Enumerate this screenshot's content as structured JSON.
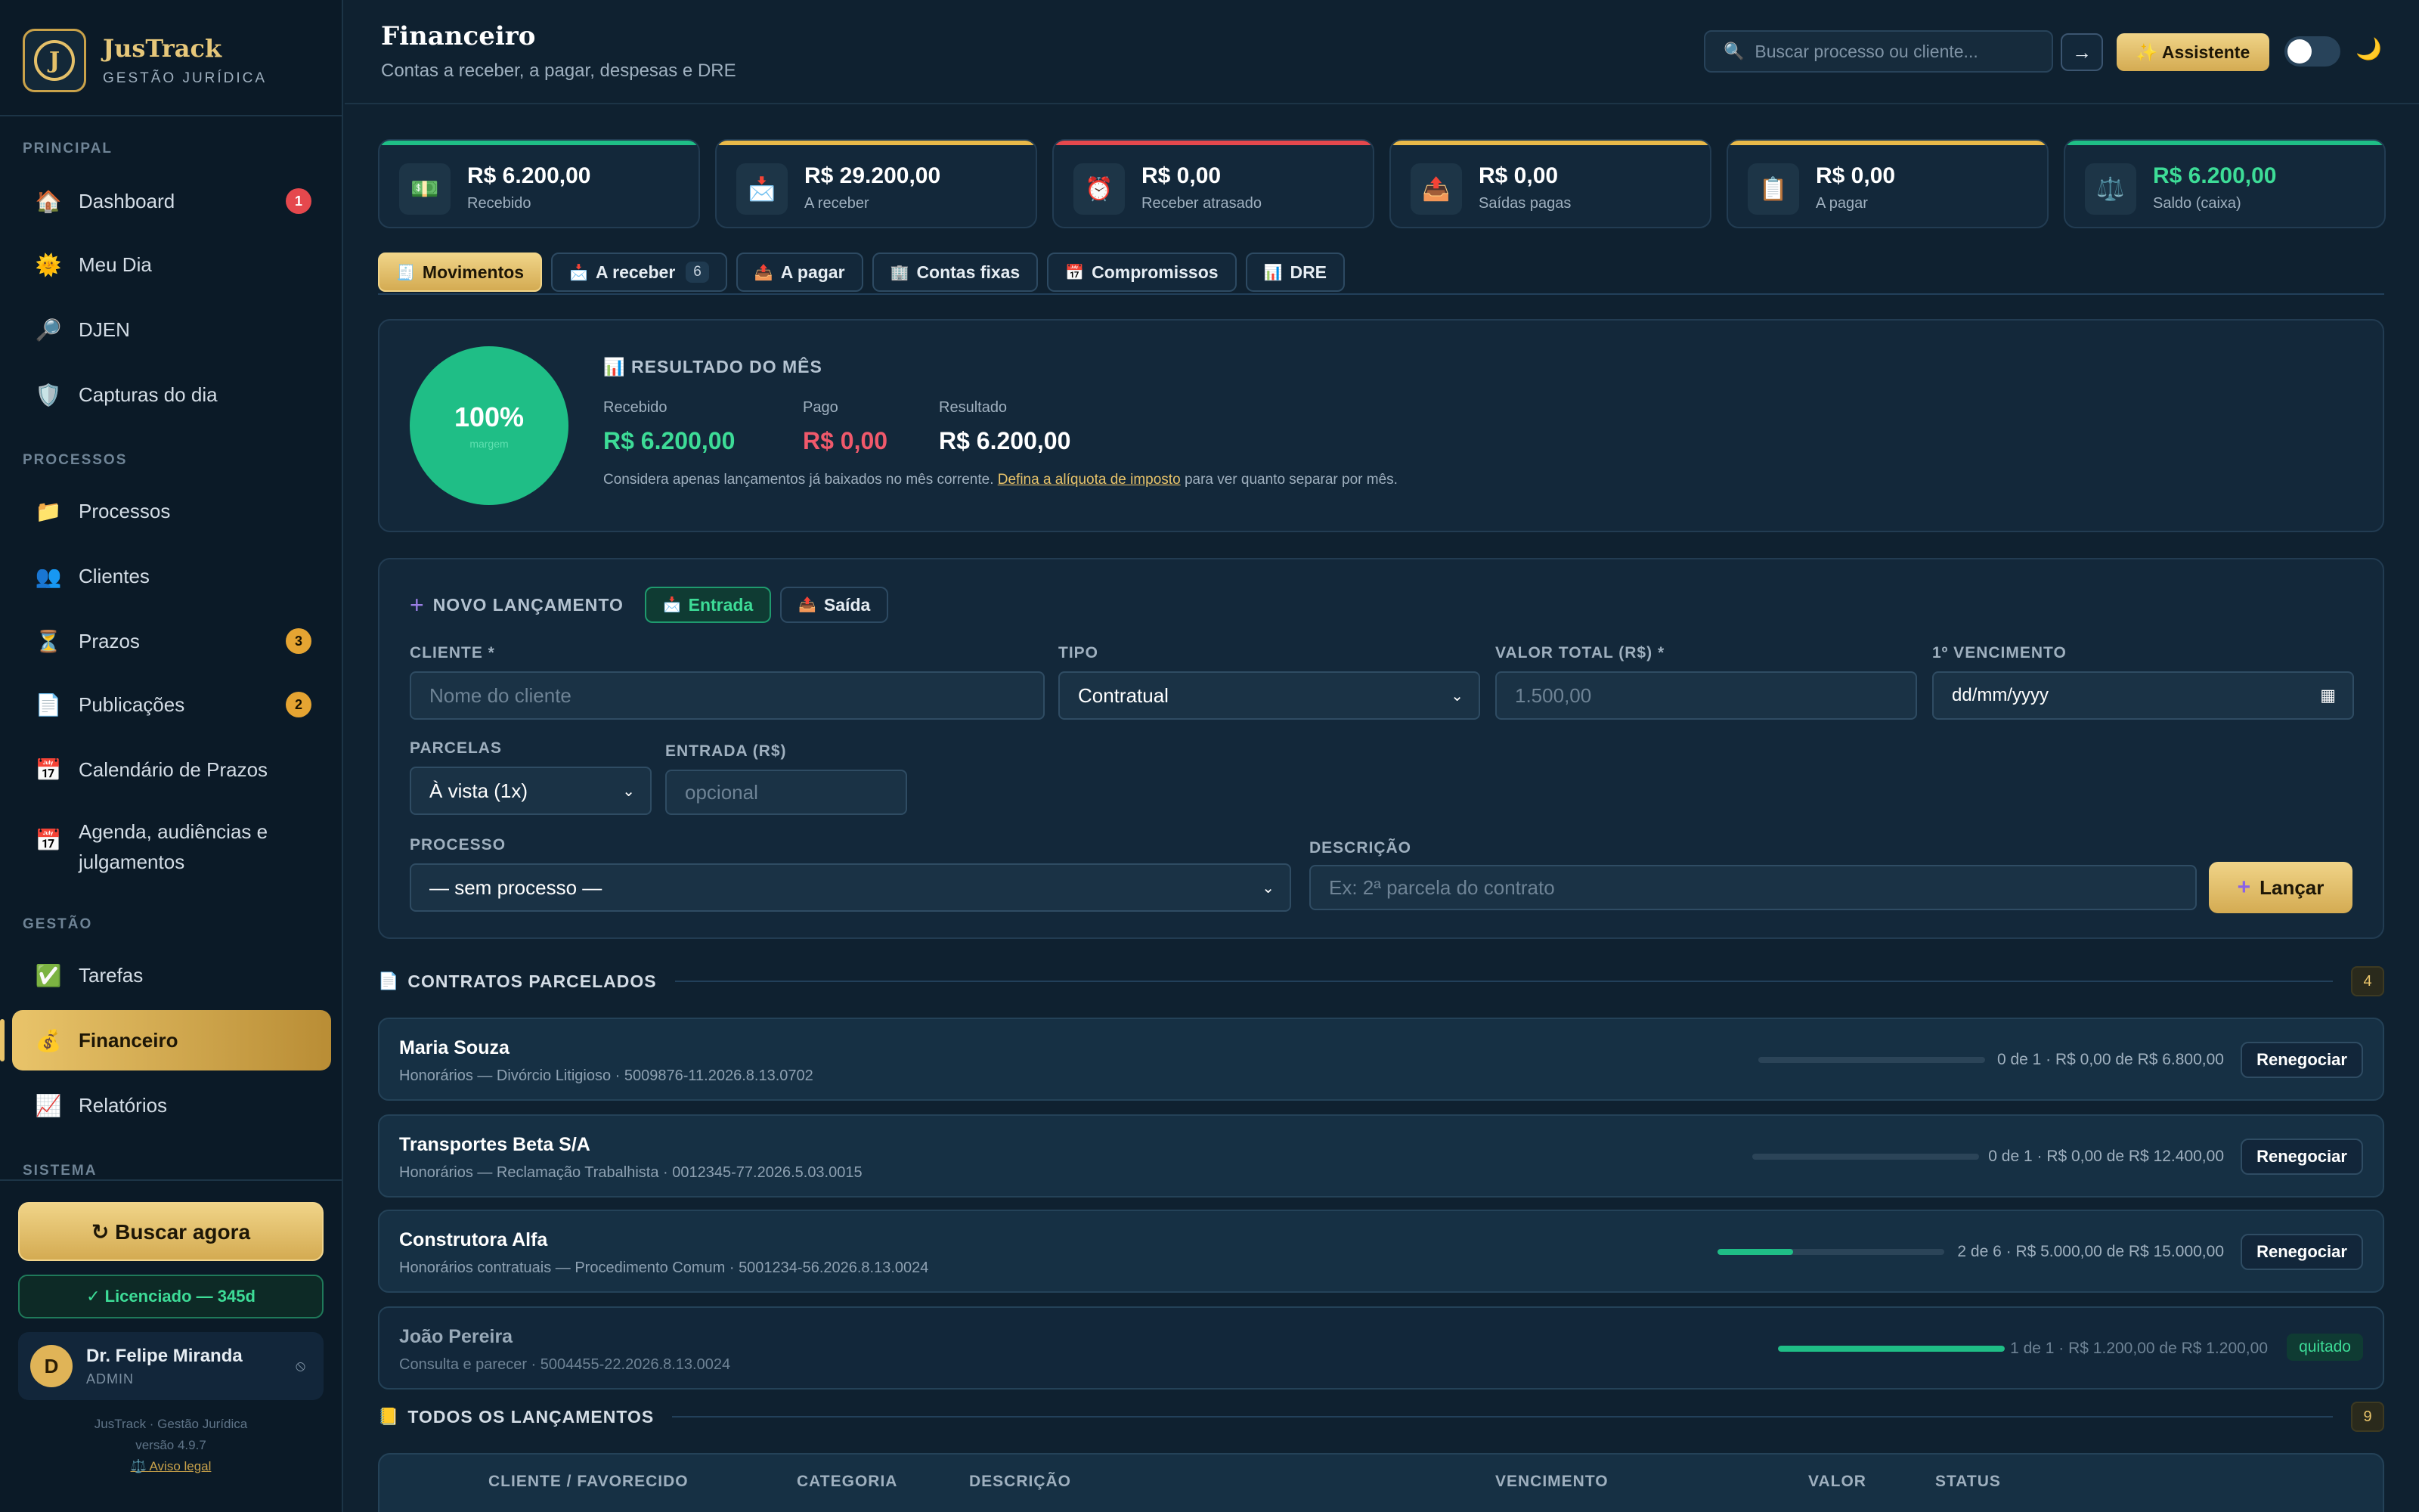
{
  "brand": {
    "logo_letter": "J",
    "name": "JusTrack",
    "subtitle": "GESTÃO JURÍDICA"
  },
  "sidebar": {
    "sections": {
      "principal": "PRINCIPAL",
      "processos": "PROCESSOS",
      "gestao": "GESTÃO",
      "sistema": "SISTEMA"
    },
    "items": [
      {
        "label": "Dashboard",
        "icon": "🏠",
        "icon_name": "home-icon",
        "badge": "1"
      },
      {
        "label": "Meu Dia",
        "icon": "🌞",
        "icon_name": "sun-icon"
      },
      {
        "label": "DJEN",
        "icon": "🔎",
        "icon_name": "search-icon"
      },
      {
        "label": "Capturas do dia",
        "icon": "🛡️",
        "icon_name": "shield-icon"
      },
      {
        "label": "Processos",
        "icon": "📁",
        "icon_name": "folder-icon"
      },
      {
        "label": "Clientes",
        "icon": "👥",
        "icon_name": "users-icon"
      },
      {
        "label": "Prazos",
        "icon": "⏳",
        "icon_name": "hourglass-icon",
        "badge": "3"
      },
      {
        "label": "Publicações",
        "icon": "📄",
        "icon_name": "document-icon",
        "badge": "2"
      },
      {
        "label": "Calendário de Prazos",
        "icon": "📅",
        "icon_name": "calendar-icon"
      },
      {
        "label_line1": "Agenda, audiências e",
        "label_line2": "julgamentos",
        "icon": "📅",
        "icon_name": "calendar-icon"
      },
      {
        "label": "Tarefas",
        "icon": "✅",
        "icon_name": "checkbox-icon"
      },
      {
        "label": "Financeiro",
        "icon": "💰",
        "icon_name": "money-bag-icon"
      },
      {
        "label": "Relatórios",
        "icon": "📈",
        "icon_name": "chart-icon"
      }
    ],
    "buscar_label": "↻ Buscar agora",
    "license": "✓ Licenciado — 345d",
    "user": {
      "initial": "D",
      "name": "Dr. Felipe Miranda",
      "role": "ADMIN",
      "logout_icon": "⦸"
    },
    "footer": {
      "line1": "JusTrack · Gestão Jurídica",
      "line2": "versão 4.9.7",
      "legal": "⚖️ Aviso legal"
    }
  },
  "header": {
    "title": "Financeiro",
    "subtitle": "Contas a receber, a pagar, despesas e DRE",
    "search_icon": "🔍",
    "search_placeholder": "Buscar processo ou cliente...",
    "go_label": "→",
    "assistant_label": "✨ Assistente",
    "theme_icon": "🌙"
  },
  "stats": [
    {
      "value": "R$ 6.200,00",
      "label": "Recebido",
      "icon": "💵",
      "accent": "#1fbe86",
      "value_color": "#ffffff"
    },
    {
      "value": "R$ 29.200,00",
      "label": "A receber",
      "icon": "📩",
      "accent": "#e9b949",
      "value_color": "#ffffff"
    },
    {
      "value": "R$ 0,00",
      "label": "Receber atrasado",
      "icon": "⏰",
      "accent": "#e5484d",
      "value_color": "#ffffff"
    },
    {
      "value": "R$ 0,00",
      "label": "Saídas pagas",
      "icon": "📤",
      "accent": "#e9b949",
      "value_color": "#ffffff"
    },
    {
      "value": "R$ 0,00",
      "label": "A pagar",
      "icon": "📋",
      "accent": "#e9b949",
      "value_color": "#ffffff"
    },
    {
      "value": "R$ 6.200,00",
      "label": "Saldo (caixa)",
      "icon": "⚖️",
      "accent": "#1fbe86",
      "value_color": "#3ddc97"
    }
  ],
  "tabs": [
    {
      "label": "Movimentos",
      "icon": "🧾"
    },
    {
      "label": "A receber",
      "icon": "📩",
      "count": "6"
    },
    {
      "label": "A pagar",
      "icon": "📤"
    },
    {
      "label": "Contas fixas",
      "icon": "🏢"
    },
    {
      "label": "Compromissos",
      "icon": "📅"
    },
    {
      "label": "DRE",
      "icon": "📊"
    }
  ],
  "result": {
    "percent": "100%",
    "percent_sub": "margem",
    "title_icon": "📊",
    "title": "RESULTADO DO MÊS",
    "received_label": "Recebido",
    "received_value": "R$ 6.200,00",
    "paid_label": "Pago",
    "paid_value": "R$ 0,00",
    "result_label": "Resultado",
    "result_value": "R$ 6.200,00",
    "note_before": "Considera apenas lançamentos já baixados no mês corrente.",
    "note_link": "Defina a alíquota de imposto",
    "note_after": "para ver quanto separar por mês."
  },
  "form": {
    "title": "NOVO LANÇAMENTO",
    "entrada_label": "Entrada",
    "saida_label": "Saída",
    "cliente_label": "CLIENTE *",
    "cliente_placeholder": "Nome do cliente",
    "tipo_label": "TIPO",
    "tipo_value": "Contratual",
    "valor_label": "VALOR TOTAL (R$) *",
    "valor_placeholder": "1.500,00",
    "venc_label": "1º VENCIMENTO",
    "venc_placeholder": "dd/mm/yyyy",
    "parcelas_label": "PARCELAS",
    "parcelas_value": "À vista (1x)",
    "entrada_valor_label": "ENTRADA (R$)",
    "entrada_placeholder": "opcional",
    "processo_label": "PROCESSO",
    "processo_value": "— sem processo —",
    "descricao_label": "DESCRIÇÃO",
    "descricao_placeholder": "Ex: 2ª parcela do contrato",
    "submit_label": "Lançar"
  },
  "contracts": {
    "title": "CONTRATOS PARCELADOS",
    "count": "4",
    "rows": [
      {
        "name": "Maria Souza",
        "desc": "Honorários — Divórcio Litigioso · 5009876-11.2026.8.13.0702",
        "progress": 0,
        "info": "0 de 1 · R$ 0,00 de R$ 6.800,00",
        "action": "Renegociar"
      },
      {
        "name": "Transportes Beta S/A",
        "desc": "Honorários — Reclamação Trabalhista · 0012345-77.2026.5.03.0015",
        "progress": 0,
        "info": "0 de 1 · R$ 0,00 de R$ 12.400,00",
        "action": "Renegociar"
      },
      {
        "name": "Construtora Alfa",
        "desc": "Honorários contratuais — Procedimento Comum · 5001234-56.2026.8.13.0024",
        "progress": 0.333,
        "info": "2 de 6 · R$ 5.000,00 de R$ 15.000,00",
        "action": "Renegociar"
      },
      {
        "name": "João Pereira",
        "desc": "Consulta e parecer · 5004455-22.2026.8.13.0024",
        "progress": 1,
        "info": "1 de 1 · R$ 1.200,00 de R$ 1.200,00",
        "status": "quitado"
      }
    ]
  },
  "launches": {
    "title": "TODOS OS LANÇAMENTOS",
    "count": "9",
    "columns": [
      "CLIENTE / FAVORECIDO",
      "CATEGORIA",
      "DESCRIÇÃO",
      "VENCIMENTO",
      "VALOR",
      "STATUS"
    ]
  }
}
